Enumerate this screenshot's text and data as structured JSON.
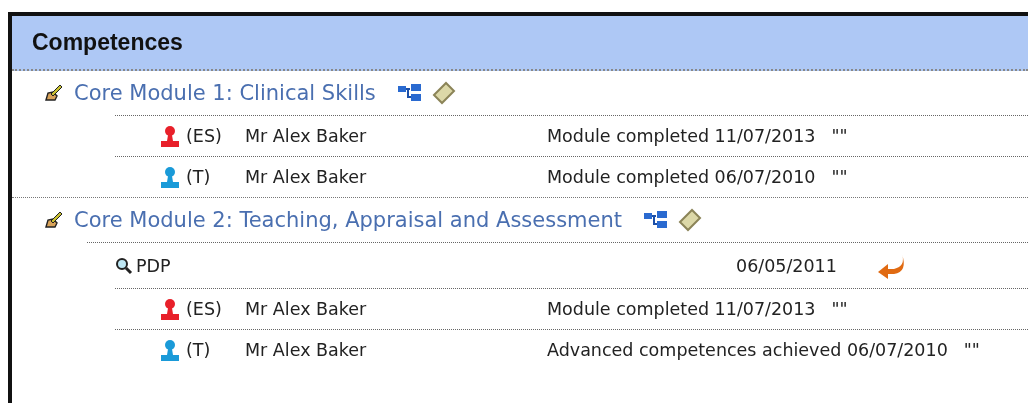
{
  "panel": {
    "title": "Competences"
  },
  "modules": [
    {
      "title": "Core Module 1: Clinical Skills",
      "entries": [
        {
          "kind": "person",
          "color": "#e8202a",
          "role": "(ES)",
          "name": "Mr Alex Baker",
          "status": "Module completed 11/07/2013",
          "note": "\"\""
        },
        {
          "kind": "person",
          "color": "#1a9ad8",
          "role": "(T)",
          "name": "Mr Alex Baker",
          "status": "Module completed 06/07/2010",
          "note": "\"\""
        }
      ]
    },
    {
      "title": "Core Module 2: Teaching, Appraisal and Assessment",
      "entries": [
        {
          "kind": "document",
          "name": "PDP",
          "date": "06/05/2011"
        },
        {
          "kind": "person",
          "color": "#e8202a",
          "role": "(ES)",
          "name": "Mr Alex Baker",
          "status": "Module completed 11/07/2013",
          "note": "\"\""
        },
        {
          "kind": "person",
          "color": "#1a9ad8",
          "role": "(T)",
          "name": "Mr Alex Baker",
          "status": "Advanced competences achieved 06/07/2010",
          "note": "\"\""
        }
      ]
    }
  ]
}
